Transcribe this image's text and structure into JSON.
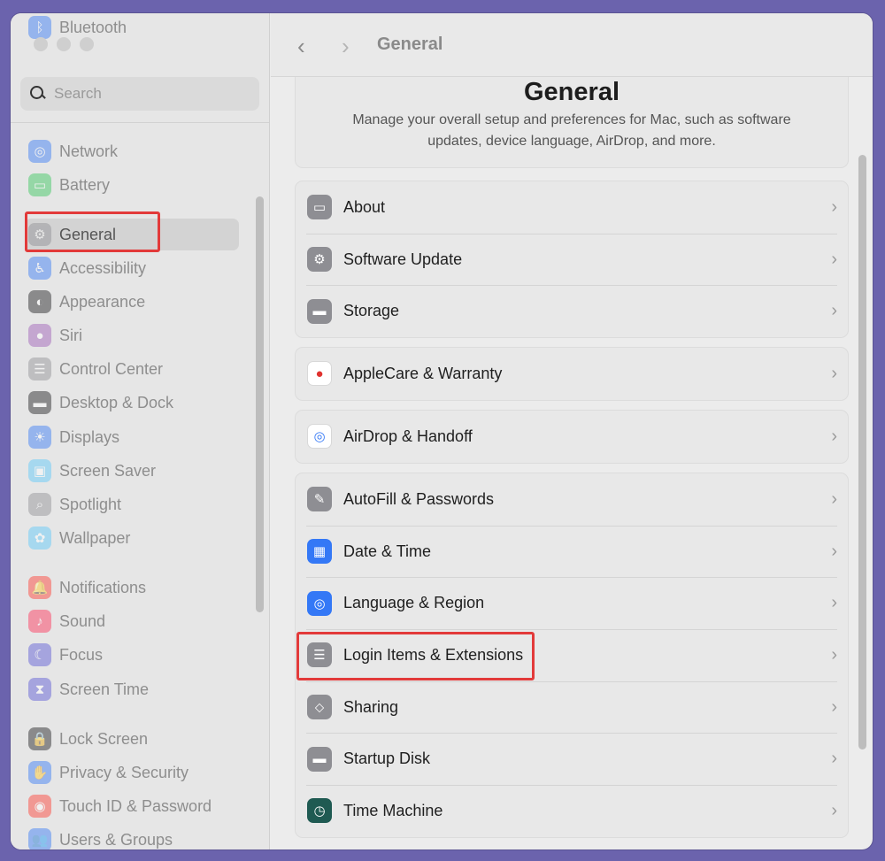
{
  "window": {
    "title": "General"
  },
  "search": {
    "placeholder": "Search"
  },
  "sidebar": {
    "items": [
      {
        "label": "Bluetooth",
        "icon": "bluetooth-icon",
        "color": "#3478f6",
        "glyph": "ᛒ"
      },
      {
        "label": "Network",
        "icon": "globe-icon",
        "color": "#3478f6",
        "glyph": "◎"
      },
      {
        "label": "Battery",
        "icon": "battery-icon",
        "color": "#34c759",
        "glyph": "▭"
      },
      {
        "label": "General",
        "icon": "gear-icon",
        "color": "#8e8e93",
        "glyph": "⚙"
      },
      {
        "label": "Accessibility",
        "icon": "accessibility-icon",
        "color": "#3478f6",
        "glyph": "♿"
      },
      {
        "label": "Appearance",
        "icon": "appearance-icon",
        "color": "#1c1c1e",
        "glyph": "◐"
      },
      {
        "label": "Siri",
        "icon": "siri-icon",
        "color": "#9b59b6",
        "glyph": "●"
      },
      {
        "label": "Control Center",
        "icon": "control-center-icon",
        "color": "#8e8e93",
        "glyph": "☰"
      },
      {
        "label": "Desktop & Dock",
        "icon": "dock-icon",
        "color": "#1c1c1e",
        "glyph": "▬"
      },
      {
        "label": "Displays",
        "icon": "displays-icon",
        "color": "#3478f6",
        "glyph": "☀"
      },
      {
        "label": "Screen Saver",
        "icon": "screen-saver-icon",
        "color": "#5ac8fa",
        "glyph": "▣"
      },
      {
        "label": "Spotlight",
        "icon": "spotlight-icon",
        "color": "#8e8e93",
        "glyph": "⌕"
      },
      {
        "label": "Wallpaper",
        "icon": "wallpaper-icon",
        "color": "#5ac8fa",
        "glyph": "✿"
      },
      {
        "label": "Notifications",
        "icon": "notifications-icon",
        "color": "#ff3b30",
        "glyph": "🔔"
      },
      {
        "label": "Sound",
        "icon": "sound-icon",
        "color": "#ff2d55",
        "glyph": "♪"
      },
      {
        "label": "Focus",
        "icon": "focus-icon",
        "color": "#5856d6",
        "glyph": "☾"
      },
      {
        "label": "Screen Time",
        "icon": "screen-time-icon",
        "color": "#5856d6",
        "glyph": "⧗"
      },
      {
        "label": "Lock Screen",
        "icon": "lock-icon",
        "color": "#1c1c1e",
        "glyph": "🔒"
      },
      {
        "label": "Privacy & Security",
        "icon": "privacy-hand-icon",
        "color": "#3478f6",
        "glyph": "✋"
      },
      {
        "label": "Touch ID & Password",
        "icon": "fingerprint-icon",
        "color": "#ff3b30",
        "glyph": "◉"
      },
      {
        "label": "Users & Groups",
        "icon": "users-icon",
        "color": "#3478f6",
        "glyph": "👥"
      }
    ]
  },
  "header": {
    "title": "General",
    "description": "Manage your overall setup and preferences for Mac, such as software updates, device language, AirDrop, and more."
  },
  "groups": [
    [
      {
        "label": "About",
        "icon": "laptop-icon",
        "color": "#8e8e93",
        "glyph": "▭"
      },
      {
        "label": "Software Update",
        "icon": "software-update-icon",
        "color": "#8e8e93",
        "glyph": "⚙"
      },
      {
        "label": "Storage",
        "icon": "storage-icon",
        "color": "#8e8e93",
        "glyph": "▬"
      }
    ],
    [
      {
        "label": "AppleCare & Warranty",
        "icon": "apple-icon",
        "color": "#ffffff",
        "glyph": "●",
        "glyph_color": "#e0322f"
      }
    ],
    [
      {
        "label": "AirDrop & Handoff",
        "icon": "airdrop-icon",
        "color": "#ffffff",
        "glyph": "◎",
        "glyph_color": "#3478f6"
      }
    ],
    [
      {
        "label": "AutoFill & Passwords",
        "icon": "autofill-icon",
        "color": "#8e8e93",
        "glyph": "✎"
      },
      {
        "label": "Date & Time",
        "icon": "calendar-icon",
        "color": "#3478f6",
        "glyph": "▦"
      },
      {
        "label": "Language & Region",
        "icon": "globe-icon",
        "color": "#3478f6",
        "glyph": "◎"
      },
      {
        "label": "Login Items & Extensions",
        "icon": "list-icon",
        "color": "#8e8e93",
        "glyph": "☰"
      },
      {
        "label": "Sharing",
        "icon": "sharing-icon",
        "color": "#8e8e93",
        "glyph": "⬦"
      },
      {
        "label": "Startup Disk",
        "icon": "disk-icon",
        "color": "#8e8e93",
        "glyph": "▬"
      },
      {
        "label": "Time Machine",
        "icon": "time-machine-icon",
        "color": "#1f5a52",
        "glyph": "◷"
      }
    ]
  ]
}
